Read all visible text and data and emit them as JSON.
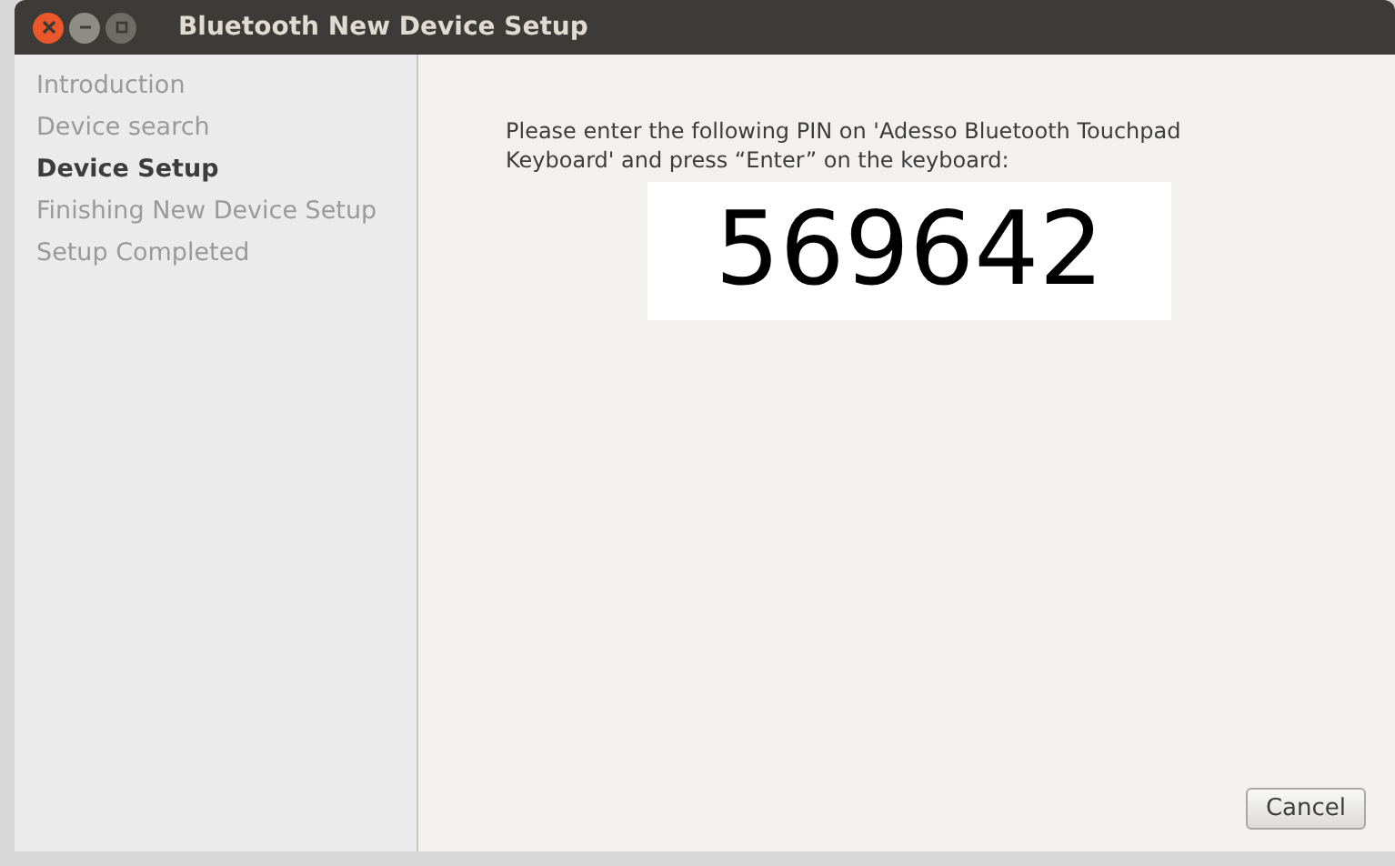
{
  "window": {
    "title": "Bluetooth New Device Setup"
  },
  "steps": [
    {
      "label": "Introduction",
      "selected": false
    },
    {
      "label": "Device search",
      "selected": false
    },
    {
      "label": "Device Setup",
      "selected": true
    },
    {
      "label": "Finishing New Device Setup",
      "selected": false
    },
    {
      "label": "Setup Completed",
      "selected": false
    }
  ],
  "instruction": "Please enter the following PIN on 'Adesso Bluetooth Touchpad Keyboard' and press “Enter” on the keyboard:",
  "pin": "569642",
  "buttons": [
    {
      "label": "Cancel"
    }
  ]
}
